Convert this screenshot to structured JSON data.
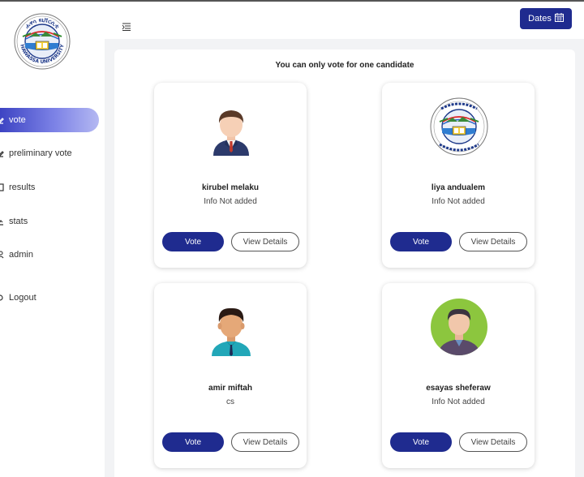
{
  "sidebar": {
    "logo": {
      "top_text": "ሐዋሳ ዩኒቨርሲቲ",
      "bottom_text": "HAWASSA UNIVERSITY"
    },
    "items": [
      {
        "label": "vote",
        "icon": "vote-icon",
        "active": true
      },
      {
        "label": "preliminary vote",
        "icon": "preliminary-icon",
        "active": false
      },
      {
        "label": "results",
        "icon": "results-icon",
        "active": false
      },
      {
        "label": "stats",
        "icon": "stats-icon",
        "active": false
      },
      {
        "label": "admin",
        "icon": "admin-icon",
        "active": false
      }
    ],
    "logout_label": "Logout"
  },
  "header": {
    "menu_icon": "menu-toggle-icon",
    "dates_label": "Dates",
    "dates_icon": "calendar-icon"
  },
  "main": {
    "notice": "You can only vote for one candidate",
    "candidates": [
      {
        "name": "kirubel melaku",
        "info": "Info Not added",
        "avatar": "man-suit-avatar"
      },
      {
        "name": "liya andualem",
        "info": "Info Not added",
        "avatar": "university-logo-avatar"
      },
      {
        "name": "amir miftah",
        "info": "cs",
        "avatar": "man-teal-shirt-avatar"
      },
      {
        "name": "esayas sheferaw",
        "info": "Info Not added",
        "avatar": "man-green-circle-avatar"
      }
    ],
    "vote_label": "Vote",
    "details_label": "View Details"
  },
  "colors": {
    "primary": "#1f2b8f",
    "active_gradient_start": "#3d44c3",
    "active_gradient_end": "#b4b8f2",
    "page_background": "#f2f3f5"
  }
}
